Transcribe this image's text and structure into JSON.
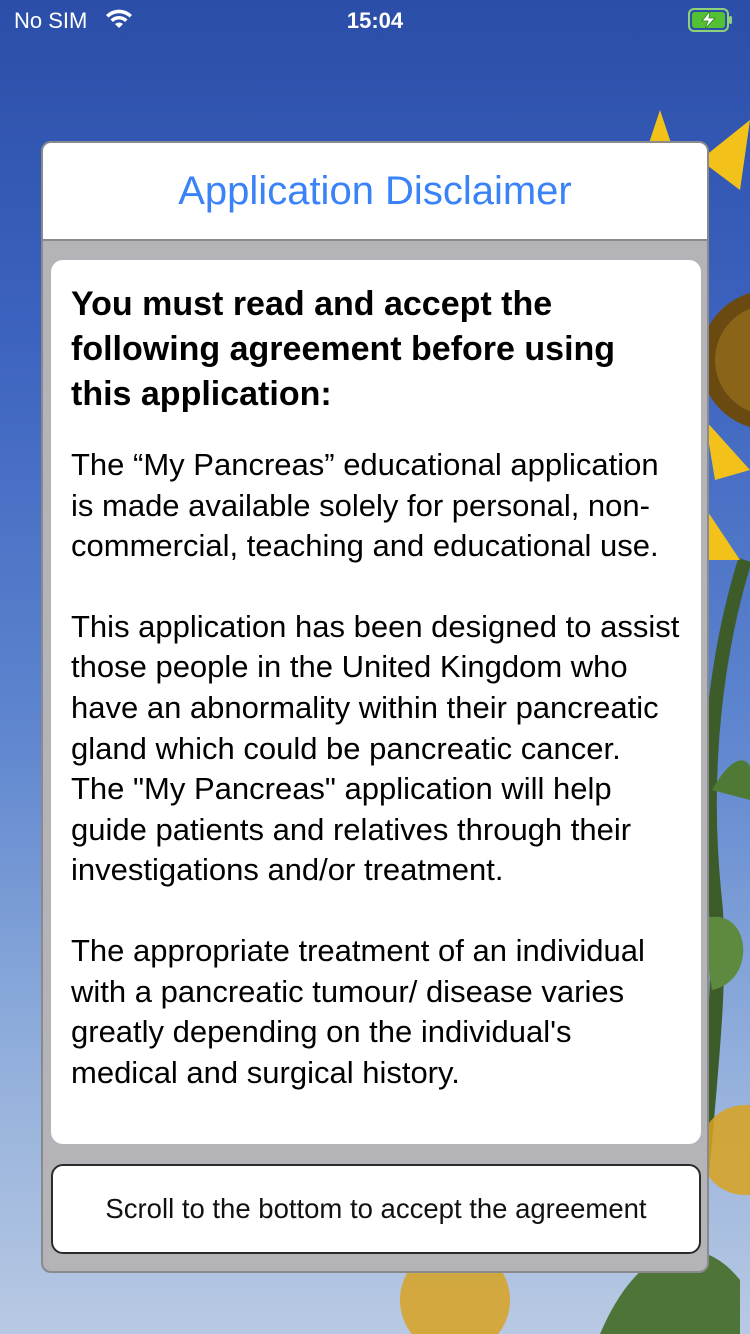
{
  "status_bar": {
    "carrier": "No SIM",
    "time": "15:04",
    "wifi_icon": "wifi-icon",
    "battery_icon": "battery-charging-icon"
  },
  "dialog": {
    "title": "Application Disclaimer",
    "heading": "You must read and accept the following agreement before using this application:",
    "paragraphs": [
      "The “My Pancreas” educational application is made available solely for personal, non-commercial, teaching and educational use.",
      "This application has been designed to assist those people in the United Kingdom who have an abnormality within their pancreatic gland which could be pancreatic cancer. The \"My Pancreas\" application will help guide patients and relatives through their investigations and/or treatment.",
      "The appropriate treatment of an individual with a pancreatic tumour/ disease varies greatly depending on the individual's medical and surgical history."
    ],
    "accept_button_label": "Scroll to the bottom to accept the agreement"
  },
  "colors": {
    "title": "#3a82f7",
    "sky_top": "#2b4ea8",
    "sky_bottom": "#b8c9e3",
    "dialog_frame": "#b3b3b8"
  }
}
